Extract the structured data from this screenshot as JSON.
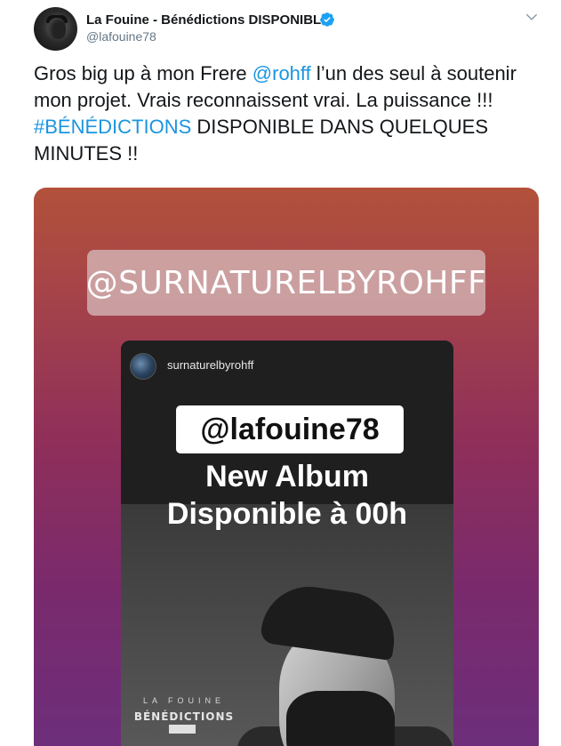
{
  "tweet": {
    "author_name": "La Fouine - Bénédictions DISPONIBLE",
    "author_handle": "@lafouine78",
    "text": {
      "part1": "Gros big up à mon Frere ",
      "mention": "@rohff",
      "part2": " l’un des seul à soutenir mon projet. Vrais reconnaissent vrai. La puissance !!! ",
      "hashtag": "#BÉNÉDICTIONS",
      "part3": " DISPONIBLE DANS QUELQUES MINUTES !!"
    },
    "link_color": "#1b95e0",
    "verified_color": "#1da1f2"
  },
  "media": {
    "ig_handle": "@SURNATURELBYROHFF",
    "story": {
      "username": "surnaturelbyrohff",
      "mention": "@lafouine78",
      "line1": "New Album",
      "line2": "Disponible à 00h",
      "cover_artist": "LA FOUINE",
      "cover_title": "BÉNÉDICTIONS"
    }
  },
  "icons": {
    "verified": "verified-badge-icon",
    "menu": "chevron-down-icon"
  }
}
